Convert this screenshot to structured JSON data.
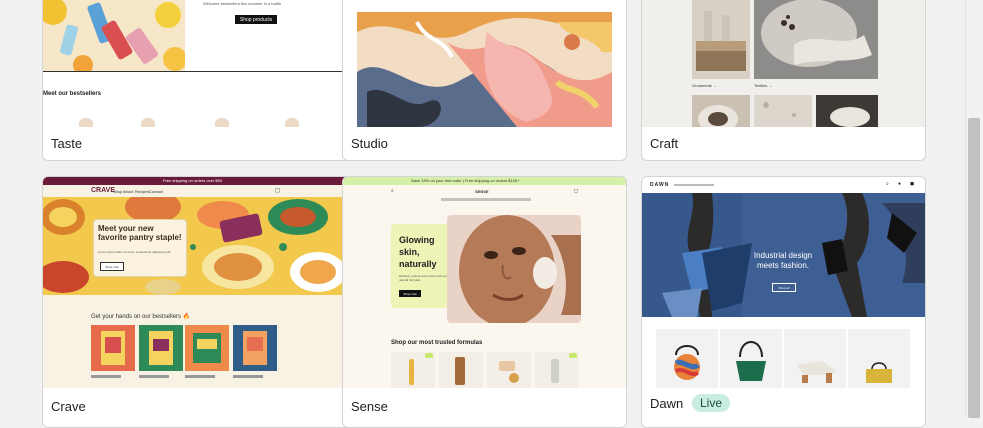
{
  "themes": [
    {
      "name": "Taste"
    },
    {
      "name": "Studio"
    },
    {
      "name": "Craft"
    },
    {
      "name": "Crave"
    },
    {
      "name": "Sense"
    },
    {
      "name": "Dawn",
      "badge": "Live"
    }
  ],
  "taste": {
    "tagline": "Welcome bestsellers this summer in a bottle",
    "cta": "Shop products",
    "section_title": "Meet our bestsellers"
  },
  "craft": {
    "label_left": "Ornaments →",
    "label_right": "Textiles →"
  },
  "crave": {
    "announcement": "Free shipping on orders over $50",
    "logo": "CRAVE",
    "nav": [
      "Shop",
      "About",
      "Recipes",
      "Contact"
    ],
    "hero_title": "Meet your new favorite pantry staple!",
    "hero_text": "Lorem ipsum dolor sit amet, consectetur adipiscing elit",
    "hero_button": "Shop now",
    "bestsellers_title": "Get your hands on our bestsellers 🔥"
  },
  "sense": {
    "announcement": "Save 15% on your first order | Free shipping on orders $100+",
    "logo": "SENSE",
    "hero_title": "Glowing skin, naturally",
    "hero_text": "Refresh, restore and renew with our natural formulas",
    "hero_button": "Shop now",
    "section_title": "Shop our most trusted formulas"
  },
  "dawn": {
    "logo": "DAWN",
    "hero_title": "Industrial design meets fashion.",
    "hero_button": "Shop all"
  },
  "colors": {
    "crave_hero": "#f2c94c",
    "sense_bg": "#fbf7ef",
    "dawn_blue": "#3e5f93",
    "live_badge": "#c9eedf"
  }
}
